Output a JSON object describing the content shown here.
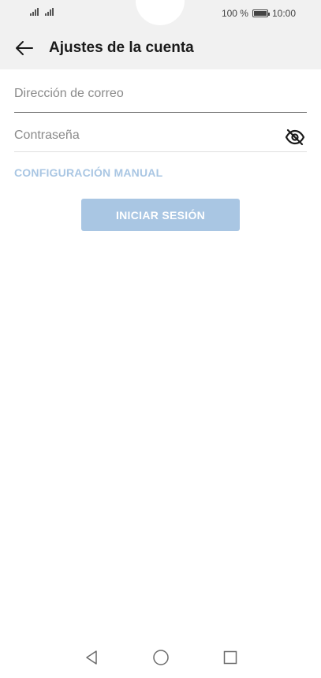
{
  "status_bar": {
    "battery_percent": "100 %",
    "time": "10:00",
    "icons": [
      "signal-icon",
      "signal-icon",
      "battery-icon"
    ]
  },
  "header": {
    "title": "Ajustes de la cuenta",
    "back_icon": "arrow-left-icon"
  },
  "form": {
    "email": {
      "placeholder": "Dirección de correo",
      "value": ""
    },
    "password": {
      "placeholder": "Contraseña",
      "value": "",
      "toggle_icon": "eye-off-icon"
    },
    "manual_config_label": "CONFIGURACIÓN MANUAL",
    "signin_label": "INICIAR SESIÓN"
  },
  "nav_bar": {
    "icons": [
      "nav-back-icon",
      "nav-home-icon",
      "nav-recents-icon"
    ]
  },
  "colors": {
    "header_bg": "#f1f1f1",
    "accent_disabled": "#a9c6e3",
    "text": "#1a1a1a",
    "placeholder": "#8a8a8a"
  }
}
